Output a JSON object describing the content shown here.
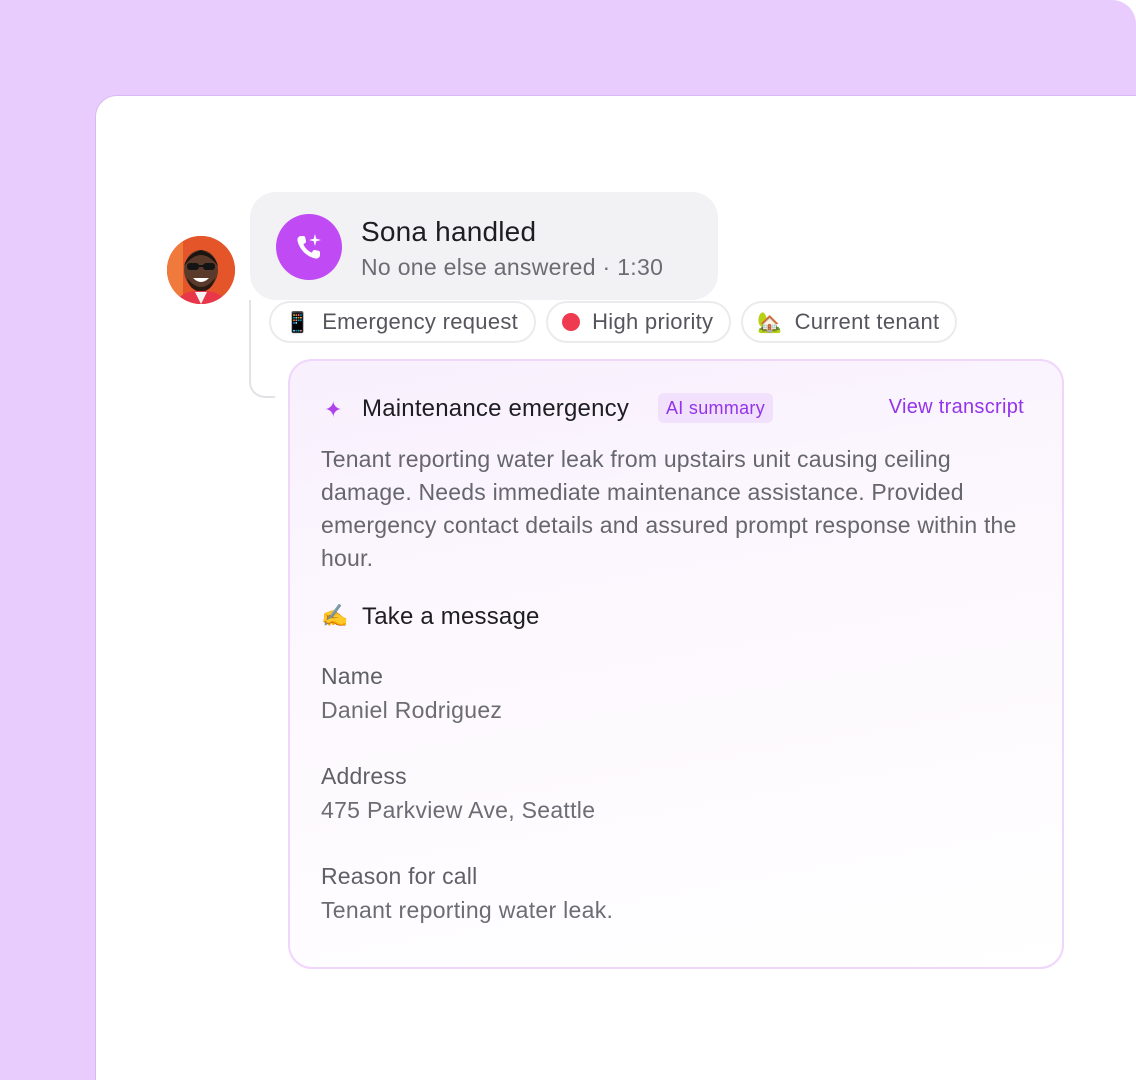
{
  "caller": {
    "avatar_icon": "person-avatar",
    "call_icon": "phone-sparkle-icon",
    "title": "Sona handled",
    "subtitle": "No one else answered · 1:30"
  },
  "tags": [
    {
      "icon": "📱",
      "icon_name": "mobile-phone-icon",
      "label": "Emergency request"
    },
    {
      "icon": "dot",
      "icon_name": "red-dot-icon",
      "label": "High priority",
      "color": "#ef3b4f"
    },
    {
      "icon": "🏡",
      "icon_name": "house-icon",
      "label": "Current tenant"
    }
  ],
  "summary": {
    "sparkle_icon": "✦",
    "title": "Maintenance emergency",
    "badge": "AI summary",
    "link": "View transcript",
    "text": "Tenant reporting water leak from upstairs unit causing ceiling damage. Needs immediate maintenance assistance. Provided emergency contact details and assured prompt response within the hour."
  },
  "message": {
    "icon": "✍️",
    "title": "Take a message",
    "fields": [
      {
        "label": "Name",
        "value": "Daniel Rodriguez"
      },
      {
        "label": "Address",
        "value": "475 Parkview Ave, Seattle"
      },
      {
        "label": "Reason for call",
        "value": "Tenant reporting water leak."
      }
    ]
  },
  "colors": {
    "accent": "#c04bf5",
    "link": "#9333ea",
    "background": "#e8ccfd"
  }
}
